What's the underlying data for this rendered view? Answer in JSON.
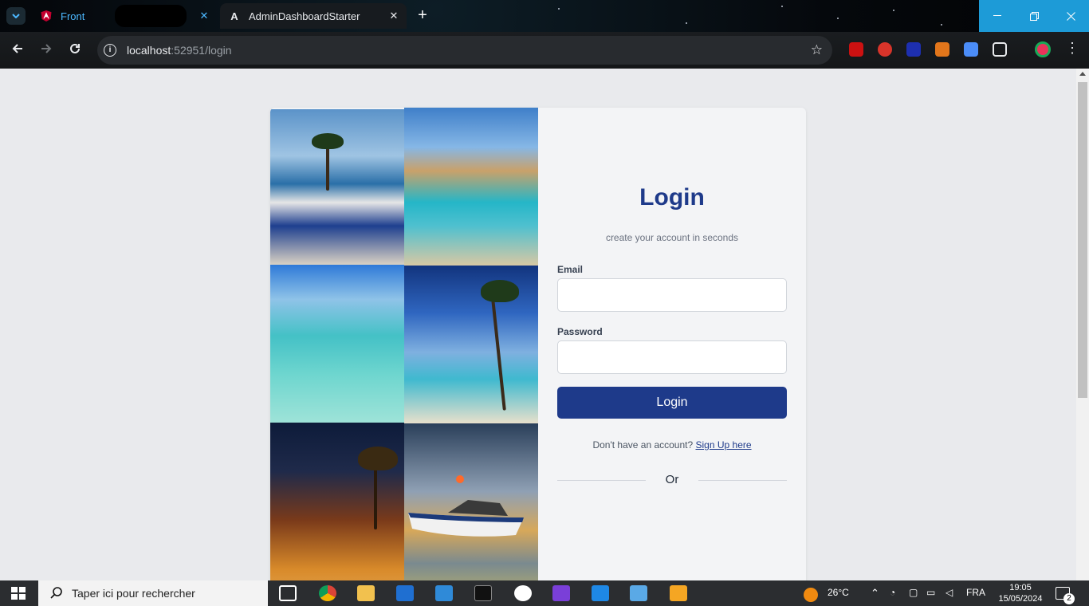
{
  "browser": {
    "tabs": [
      {
        "title": "Front",
        "active": false
      },
      {
        "title": "AdminDashboardStarter",
        "active": true
      }
    ],
    "url_host": "localhost",
    "url_rest": ":52951/login"
  },
  "login": {
    "title": "Login",
    "subtitle": "create your account in seconds",
    "email_label": "Email",
    "email_value": "",
    "password_label": "Password",
    "password_value": "",
    "submit_label": "Login",
    "signup_prompt": "Don't have an account?",
    "signup_link": "Sign Up here",
    "divider_text": "Or"
  },
  "taskbar": {
    "search_placeholder": "Taper ici pour rechercher",
    "weather": "26°C",
    "language": "FRA",
    "time": "19:05",
    "date": "15/05/2024",
    "notifications": "2"
  },
  "colors": {
    "primary": "#1e3a8a",
    "accent_tab": "#4cb8ff",
    "window_controls": "#1d9bd7"
  }
}
